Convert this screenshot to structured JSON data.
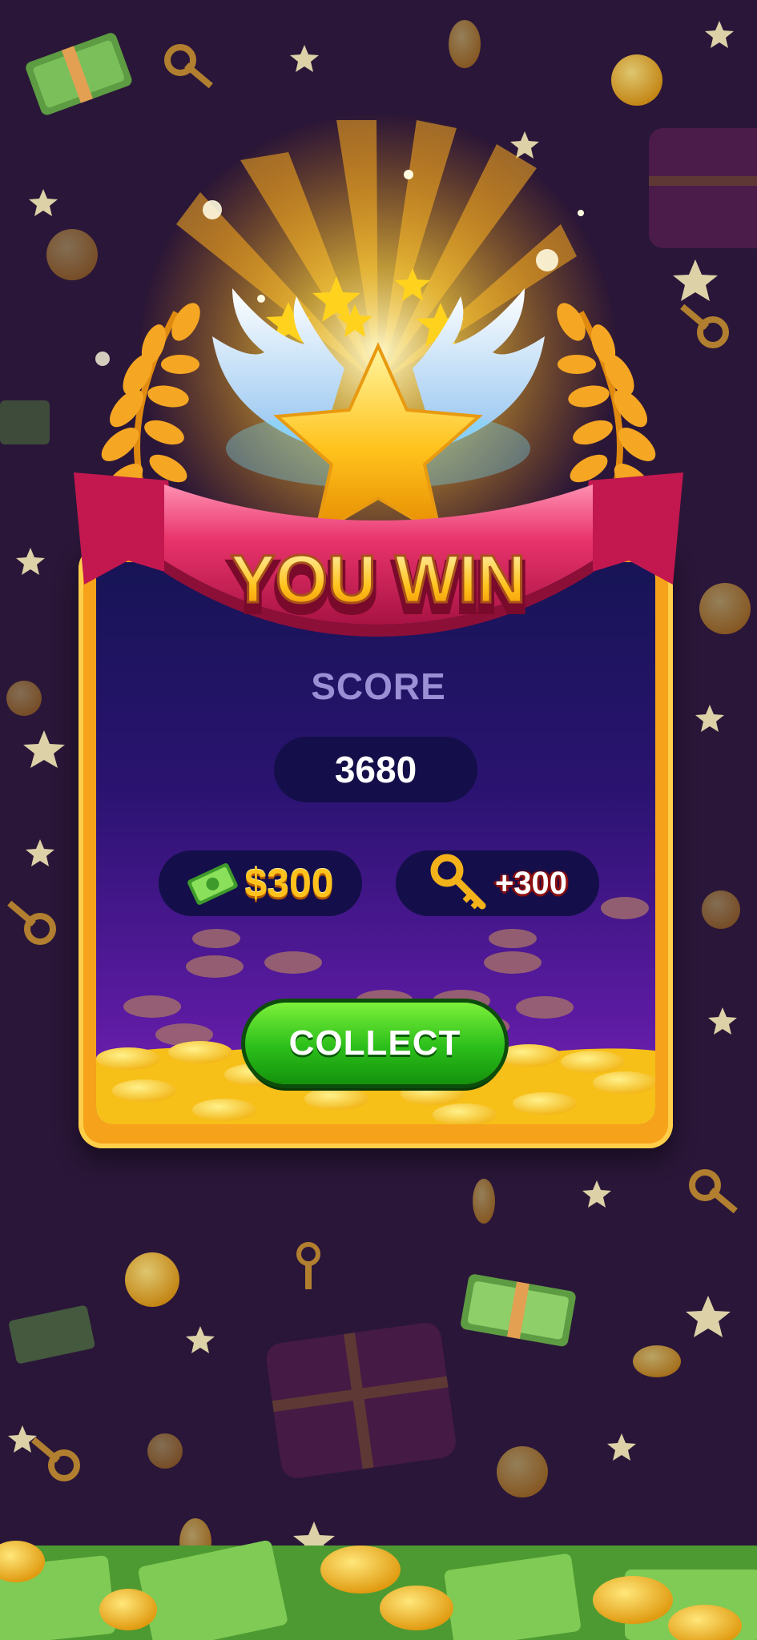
{
  "title": "YOU WIN",
  "score": {
    "label": "SCORE",
    "value": "3680"
  },
  "rewards": {
    "cash": "$300",
    "keys": "+300"
  },
  "collect_label": "COLLECT",
  "icons": [
    "star-icon",
    "wings-icon",
    "laurel-icon",
    "cash-icon",
    "key-icon",
    "coin-icon",
    "treasure-chest-icon"
  ],
  "colors": {
    "background": "#2a1638",
    "panel_border": "#f6a21a",
    "ribbon": "#e8336b",
    "button": "#2bbe1a",
    "gold": "#ffc21c"
  }
}
